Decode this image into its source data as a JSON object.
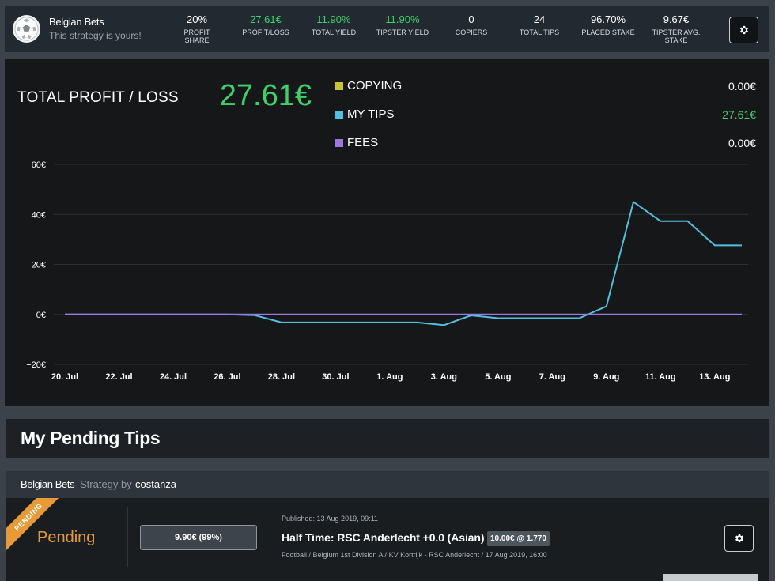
{
  "header": {
    "strategy_name": "Belgian Bets",
    "subtitle": "This strategy is yours!",
    "stats": [
      {
        "value": "20%",
        "label": "PROFIT SHARE",
        "positive": false
      },
      {
        "value": "27.61€",
        "label": "PROFIT/LOSS",
        "positive": true
      },
      {
        "value": "11.90%",
        "label": "TOTAL YIELD",
        "positive": true
      },
      {
        "value": "11.90%",
        "label": "TIPSTER YIELD",
        "positive": true
      },
      {
        "value": "0",
        "label": "COPIERS",
        "positive": false
      },
      {
        "value": "24",
        "label": "TOTAL TIPS",
        "positive": false
      },
      {
        "value": "96.70%",
        "label": "PLACED STAKE",
        "positive": false
      },
      {
        "value": "9.67€",
        "label": "TIPSTER AVG. STAKE",
        "positive": false
      }
    ],
    "settings_icon": "gear-icon"
  },
  "summary": {
    "title": "TOTAL PROFIT / LOSS",
    "value": "27.61€"
  },
  "legend": [
    {
      "label": "COPYING",
      "value": "0.00€",
      "color": "#c9c43a",
      "positive": false
    },
    {
      "label": "MY TIPS",
      "value": "27.61€",
      "color": "#52bfe0",
      "positive": true
    },
    {
      "label": "FEES",
      "value": "0.00€",
      "color": "#9b78e0",
      "positive": false
    }
  ],
  "chart_data": {
    "type": "line",
    "x_tick_labels": [
      "20. Jul",
      "22. Jul",
      "24. Jul",
      "26. Jul",
      "28. Jul",
      "30. Jul",
      "1. Aug",
      "3. Aug",
      "5. Aug",
      "7. Aug",
      "9. Aug",
      "11. Aug",
      "13. Aug"
    ],
    "y_tick_labels": [
      "60€",
      "40€",
      "20€",
      "0€",
      "−20€"
    ],
    "y_ticks": [
      60,
      40,
      20,
      0,
      -20
    ],
    "ylim": [
      -20,
      60
    ],
    "x_start": "2019-07-20",
    "x_end": "2019-08-14",
    "grid": true,
    "series": [
      {
        "name": "MY TIPS",
        "color": "#52bfe0",
        "points": [
          [
            "2019-07-20",
            0
          ],
          [
            "2019-07-26",
            0
          ],
          [
            "2019-07-27",
            -0.3
          ],
          [
            "2019-07-28",
            -3.2
          ],
          [
            "2019-07-29",
            -3.2
          ],
          [
            "2019-07-30",
            -3.2
          ],
          [
            "2019-07-31",
            -3.2
          ],
          [
            "2019-08-01",
            -3.2
          ],
          [
            "2019-08-02",
            -3.2
          ],
          [
            "2019-08-03",
            -4.3
          ],
          [
            "2019-08-04",
            -0.4
          ],
          [
            "2019-08-05",
            -1.5
          ],
          [
            "2019-08-06",
            -1.5
          ],
          [
            "2019-08-07",
            -1.5
          ],
          [
            "2019-08-08",
            -1.5
          ],
          [
            "2019-08-09",
            3.2
          ],
          [
            "2019-08-10",
            45
          ],
          [
            "2019-08-11",
            37.3
          ],
          [
            "2019-08-12",
            37.3
          ],
          [
            "2019-08-13",
            27.61
          ],
          [
            "2019-08-14",
            27.61
          ]
        ]
      },
      {
        "name": "FEES",
        "color": "#9b78e0",
        "points": [
          [
            "2019-07-20",
            0
          ],
          [
            "2019-08-14",
            0
          ]
        ]
      }
    ]
  },
  "pending": {
    "heading": "My Pending Tips"
  },
  "tip": {
    "strategy_name": "Belgian Bets",
    "strategy_by": "Strategy by",
    "author": "costanza",
    "ribbon": "PENDING",
    "status": "Pending",
    "stake": "9.90€ (99%)",
    "published": "Published: 13 Aug 2019, 09:11",
    "title": "Half Time: RSC Anderlecht +0.0 (Asian)",
    "odds": "10.00€ @ 1.770",
    "meta": "Football / Belgium 1st Division A / KV Kortrijk - RSC Anderlecht / 17 Aug 2019, 16:00",
    "settings_icon": "gear-icon"
  }
}
